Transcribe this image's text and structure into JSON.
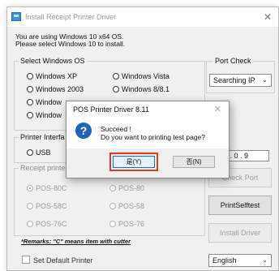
{
  "window": {
    "title": "Install Receipt Printer Driver",
    "info_line1": "You are using Windows 10 x64 OS.",
    "info_line2": "Please select Windows 10 to install."
  },
  "os_group": {
    "label": "Select Windows OS",
    "options": [
      "Windows XP",
      "Windows Vista",
      "Windows 2003",
      "Windows 8/8.1",
      "Window",
      "Window"
    ]
  },
  "port_check": {
    "label": "Port Check",
    "selected": "Searching IP"
  },
  "printer_interface": {
    "label": "Printer Interfa",
    "usb_label": "USB",
    "ip_value": "68 . 0 . 9"
  },
  "receipt_printer": {
    "label": "Receipt printe",
    "options": [
      "POS-80C",
      "POS-80",
      "POS-58C",
      "POS-58",
      "POS-76C",
      "POS-76"
    ]
  },
  "buttons": {
    "check_port": "Check Port",
    "print_selftest": "PrintSelftest",
    "install_driver": "Install Driver"
  },
  "remarks": "*Remarks: \"C\" means item with cutter",
  "set_default_label": "Set Default Printer",
  "language": {
    "selected": "English"
  },
  "dialog": {
    "title": "POS Printer Driver 8.11",
    "message1": "Succeed !",
    "message2": "Do you want to printing test page?",
    "yes_label": "是(Y)",
    "no_label": "否(N)"
  },
  "colors": {
    "highlight": "#e23a26",
    "question_icon": "#1f63c0"
  }
}
